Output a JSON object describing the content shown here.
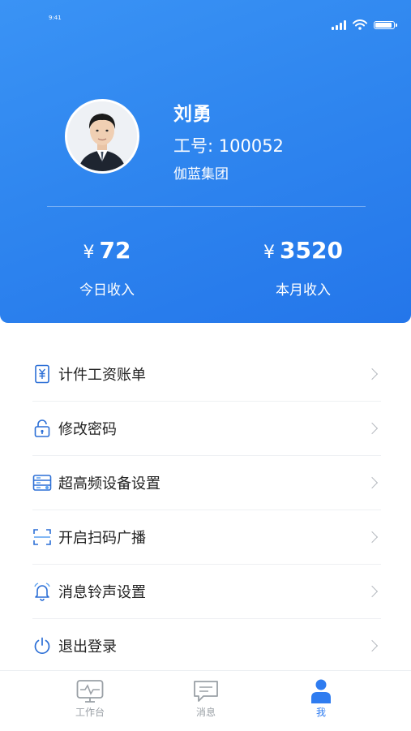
{
  "status_bar": {
    "time": "9:41"
  },
  "profile": {
    "name": "刘勇",
    "employee_id": "工号: 100052",
    "company": "伽蓝集团"
  },
  "income": {
    "currency": "¥",
    "today_amount": "72",
    "today_label": "今日收入",
    "month_amount": "3520",
    "month_label": "本月收入"
  },
  "menu": {
    "items": [
      {
        "label": "计件工资账单",
        "icon": "wage-bill-icon"
      },
      {
        "label": "修改密码",
        "icon": "lock-icon"
      },
      {
        "label": "超高频设备设置",
        "icon": "device-settings-icon"
      },
      {
        "label": "开启扫码广播",
        "icon": "scan-icon"
      },
      {
        "label": "消息铃声设置",
        "icon": "bell-icon"
      },
      {
        "label": "退出登录",
        "icon": "power-icon"
      }
    ]
  },
  "tabbar": {
    "workbench": "工作台",
    "messages": "消息",
    "me": "我"
  },
  "colors": {
    "accent": "#2f7cf0",
    "header_gradient_start": "#3a93f5",
    "header_gradient_end": "#2476ea",
    "icon_color": "#2c6fd6"
  }
}
